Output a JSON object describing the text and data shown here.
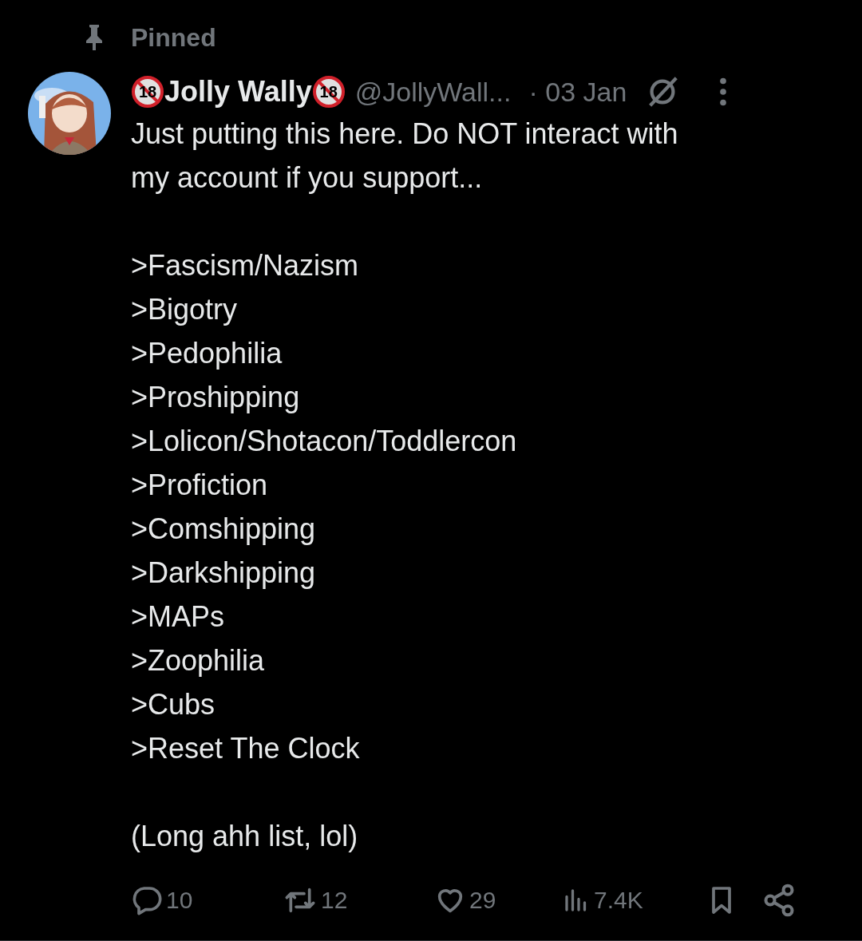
{
  "pinned_label": "Pinned",
  "tweet": {
    "name_parts": [
      {
        "kind": "badge",
        "text": "18"
      },
      {
        "kind": "name",
        "text": "Jolly Wally"
      },
      {
        "kind": "badge",
        "text": "18"
      }
    ],
    "handle": "@JollyWall...",
    "date": "· 03 Jan",
    "intro_lines": [
      "Just putting this here. Do NOT interact with",
      "my account if you support..."
    ],
    "list_items": [
      ">Fascism/Nazism",
      ">Bigotry",
      ">Pedophilia",
      ">Proshipping",
      ">Lolicon/Shotacon/Toddlercon",
      ">Profiction",
      ">Comshipping",
      ">Darkshipping",
      ">MAPs",
      ">Zoophilia",
      ">Cubs",
      ">Reset The Clock"
    ],
    "outro": "(Long ahh list, lol)",
    "actions": [
      {
        "kind": "reply",
        "count": "10"
      },
      {
        "kind": "repost",
        "count": "12"
      },
      {
        "kind": "like",
        "count": "29"
      },
      {
        "kind": "views",
        "count": "7.4K"
      },
      {
        "kind": "bookmark"
      },
      {
        "kind": "share"
      }
    ]
  }
}
